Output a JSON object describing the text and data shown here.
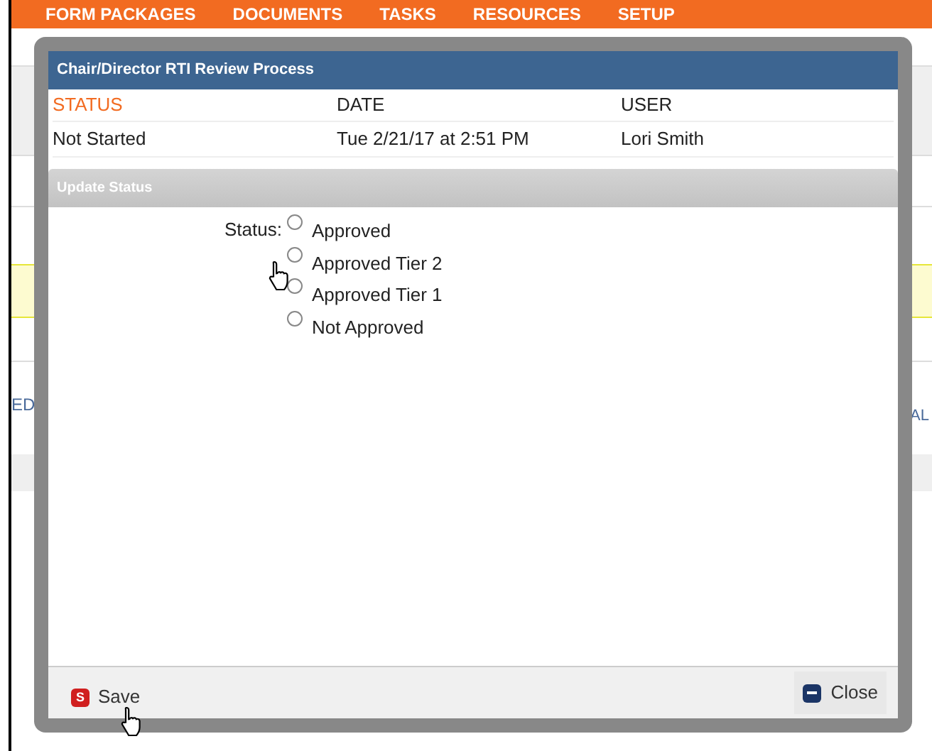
{
  "nav": {
    "items": [
      "FORM PACKAGES",
      "DOCUMENTS",
      "TASKS",
      "RESOURCES",
      "SETUP"
    ]
  },
  "background": {
    "left_text": "ED",
    "right_text": "AL"
  },
  "dialog": {
    "title": "Chair/Director RTI Review Process",
    "history": {
      "columns": [
        "STATUS",
        "DATE",
        "USER"
      ],
      "rows": [
        [
          "Not Started",
          "Tue 2/21/17 at 2:51 PM",
          "Lori Smith"
        ]
      ]
    },
    "section_title": "Update Status",
    "status_label": "Status:",
    "options": [
      {
        "label": "Approved",
        "selected": false
      },
      {
        "label": "Approved Tier 2",
        "selected": false
      },
      {
        "label": "Approved Tier 1",
        "selected": false
      },
      {
        "label": "Not Approved",
        "selected": false
      }
    ],
    "save": {
      "label": "Save",
      "icon_letter": "S"
    },
    "close": {
      "label": "Close"
    }
  }
}
